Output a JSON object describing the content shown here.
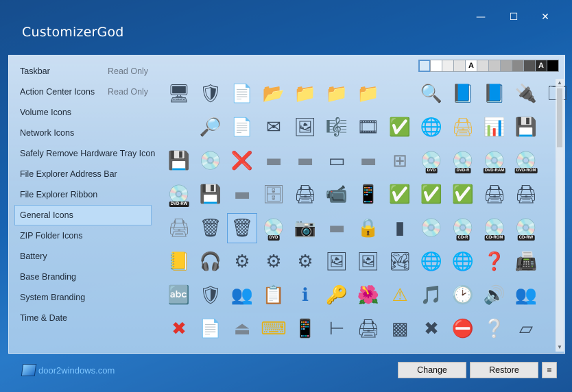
{
  "window": {
    "title": "CustomizerGod",
    "controls": {
      "minimize": "—",
      "maximize": "☐",
      "close": "✕"
    }
  },
  "sidebar": {
    "items": [
      {
        "label": "Taskbar",
        "status": "Read Only",
        "selected": false
      },
      {
        "label": "Action Center Icons",
        "status": "Read Only",
        "selected": false
      },
      {
        "label": "Volume Icons",
        "status": "",
        "selected": false
      },
      {
        "label": "Network Icons",
        "status": "",
        "selected": false
      },
      {
        "label": "Safely Remove Hardware Tray Icon",
        "status": "",
        "selected": false
      },
      {
        "label": "File Explorer Address Bar",
        "status": "",
        "selected": false
      },
      {
        "label": "File Explorer Ribbon",
        "status": "",
        "selected": false
      },
      {
        "label": "General Icons",
        "status": "",
        "selected": true
      },
      {
        "label": "ZIP Folder Icons",
        "status": "",
        "selected": false
      },
      {
        "label": "Battery",
        "status": "",
        "selected": false
      },
      {
        "label": "Base Branding",
        "status": "",
        "selected": false
      },
      {
        "label": "System Branding",
        "status": "",
        "selected": false
      },
      {
        "label": "Time & Date",
        "status": "",
        "selected": false
      }
    ]
  },
  "background_swatches": [
    {
      "color": "#d7e8f7",
      "label": "",
      "active": true
    },
    {
      "color": "#ffffff",
      "label": "",
      "active": false
    },
    {
      "color": "#eeeeee",
      "label": "",
      "active": false
    },
    {
      "color": "#e4e4e4",
      "label": "",
      "active": false
    },
    {
      "color": "#ffffff",
      "label": "A",
      "active": false
    },
    {
      "color": "#dcdcdc",
      "label": "",
      "active": false
    },
    {
      "color": "#c8c8c8",
      "label": "",
      "active": false
    },
    {
      "color": "#aaaaaa",
      "label": "",
      "active": false
    },
    {
      "color": "#8a8a8a",
      "label": "",
      "active": false
    },
    {
      "color": "#555555",
      "label": "",
      "active": false
    },
    {
      "color": "#2a2a2a",
      "label": "A",
      "active": false
    },
    {
      "color": "#000000",
      "label": "",
      "active": false
    }
  ],
  "icon_rows": [
    [
      {
        "name": "windows-display-icon",
        "glyph": "🖥"
      },
      {
        "name": "uac-shield-icon",
        "glyph": "🛡"
      },
      {
        "name": "blank-file-icon",
        "glyph": "📄"
      },
      {
        "name": "folder-open-icon",
        "glyph": "📂"
      },
      {
        "name": "folder-icon",
        "glyph": "📁"
      },
      {
        "name": "folder-icon",
        "glyph": "📁"
      },
      {
        "name": "folder-side-icon",
        "glyph": "📁"
      },
      {
        "name": "glass-file-icon",
        "glyph": ""
      },
      {
        "name": "search-globe-icon",
        "glyph": "🔍"
      },
      {
        "name": "blue-folder-icon",
        "glyph": "📘"
      },
      {
        "name": "blue-folder-side-icon",
        "glyph": "📘"
      },
      {
        "name": "network-plug-icon",
        "glyph": "🔌"
      },
      {
        "name": "window-app-icon",
        "glyph": "🗔"
      }
    ],
    [
      {
        "name": "blank-icon",
        "glyph": ""
      },
      {
        "name": "folder-search-icon",
        "glyph": "🔎"
      },
      {
        "name": "text-file-icon",
        "glyph": "📄"
      },
      {
        "name": "mail-envelope-icon",
        "glyph": "✉"
      },
      {
        "name": "picture-icon",
        "glyph": "🖼"
      },
      {
        "name": "music-sheet-icon",
        "glyph": "🎼"
      },
      {
        "name": "film-strip-icon",
        "glyph": "🎞"
      },
      {
        "name": "window-check-icon",
        "glyph": "✅"
      },
      {
        "name": "network-globe-icon",
        "glyph": "🌐"
      },
      {
        "name": "printer-folder-icon",
        "glyph": "🖨"
      },
      {
        "name": "control-panel-icon",
        "glyph": "📊"
      },
      {
        "name": "drive-floppy-icon",
        "glyph": "💾"
      },
      {
        "name": "blank-icon",
        "glyph": ""
      }
    ],
    [
      {
        "name": "drive-floppy-icon",
        "glyph": "💾"
      },
      {
        "name": "drive-cd-icon",
        "glyph": "💿"
      },
      {
        "name": "drive-disconnected-icon",
        "glyph": "❌"
      },
      {
        "name": "drive-icon",
        "glyph": "▬"
      },
      {
        "name": "drive-network-icon",
        "glyph": "▬"
      },
      {
        "name": "memory-chip-icon",
        "glyph": "▭"
      },
      {
        "name": "drive-icon",
        "glyph": "▬"
      },
      {
        "name": "drive-windows-icon",
        "glyph": "⊞"
      },
      {
        "name": "drive-dvd-icon",
        "glyph": "💿",
        "overlay": "DVD"
      },
      {
        "name": "disc-dvd-r-icon",
        "glyph": "💿",
        "overlay": "DVD-R"
      },
      {
        "name": "disc-dvd-ram-icon",
        "glyph": "💿",
        "overlay": "DVD-RAM"
      },
      {
        "name": "disc-dvd-rom-icon",
        "glyph": "💿",
        "overlay": "DVD-ROM"
      },
      {
        "name": "blank-icon",
        "glyph": ""
      }
    ],
    [
      {
        "name": "disc-dvd-rw-icon",
        "glyph": "💿",
        "overlay": "DVD-RW"
      },
      {
        "name": "drive-floppy-icon",
        "glyph": "💾"
      },
      {
        "name": "drive-usb-icon",
        "glyph": "▬"
      },
      {
        "name": "drive-server-icon",
        "glyph": "🗄"
      },
      {
        "name": "network-printer-icon",
        "glyph": "🖨"
      },
      {
        "name": "camcorder-icon",
        "glyph": "📹"
      },
      {
        "name": "mobile-phone-icon",
        "glyph": "📱"
      },
      {
        "name": "floppy-check-icon",
        "glyph": "✅"
      },
      {
        "name": "drive-check-icon",
        "glyph": "✅"
      },
      {
        "name": "drive-check-icon",
        "glyph": "✅"
      },
      {
        "name": "printer-icon",
        "glyph": "🖨"
      },
      {
        "name": "printer-floppy-icon",
        "glyph": "🖨"
      },
      {
        "name": "blank-icon",
        "glyph": ""
      }
    ],
    [
      {
        "name": "drive-printer-icon",
        "glyph": "🖨"
      },
      {
        "name": "recycle-bin-full-icon",
        "glyph": "🗑"
      },
      {
        "name": "recycle-bin-empty-icon",
        "glyph": "🗑"
      },
      {
        "name": "disc-dvd-icon",
        "glyph": "💿",
        "overlay": "DVD"
      },
      {
        "name": "camera-icon",
        "glyph": "📷"
      },
      {
        "name": "drive-icon",
        "glyph": "▬"
      },
      {
        "name": "padlock-icon",
        "glyph": "🔒"
      },
      {
        "name": "sd-card-icon",
        "glyph": "▮"
      },
      {
        "name": "disc-cd-icon",
        "glyph": "💿"
      },
      {
        "name": "disc-cd-r-icon",
        "glyph": "💿",
        "overlay": "CD-R"
      },
      {
        "name": "disc-cd-rom-icon",
        "glyph": "💿",
        "overlay": "CD-ROM"
      },
      {
        "name": "disc-cd-rw-icon",
        "glyph": "💿",
        "overlay": "CD-RW"
      },
      {
        "name": "blank-icon",
        "glyph": ""
      }
    ],
    [
      {
        "name": "contacts-book-icon",
        "glyph": "📒"
      },
      {
        "name": "media-player-icon",
        "glyph": "🎧"
      },
      {
        "name": "settings-file-icon",
        "glyph": "⚙"
      },
      {
        "name": "settings-window-icon",
        "glyph": "⚙"
      },
      {
        "name": "settings-gear-icon",
        "glyph": "⚙"
      },
      {
        "name": "pictures-icon",
        "glyph": "🖼"
      },
      {
        "name": "photos-icon",
        "glyph": "🖼"
      },
      {
        "name": "landscape-icon",
        "glyph": "🏞"
      },
      {
        "name": "folder-network-icon",
        "glyph": "🌐"
      },
      {
        "name": "globe-network-icon",
        "glyph": "🌐"
      },
      {
        "name": "drive-help-icon",
        "glyph": "❓"
      },
      {
        "name": "fax-printer-icon",
        "glyph": "📠"
      },
      {
        "name": "blank-icon",
        "glyph": ""
      }
    ],
    [
      {
        "name": "font-folder-icon",
        "glyph": "🔤"
      },
      {
        "name": "security-shield-icon",
        "glyph": "🛡"
      },
      {
        "name": "users-icon",
        "glyph": "👥"
      },
      {
        "name": "checklist-icon",
        "glyph": "📋"
      },
      {
        "name": "info-icon",
        "glyph": "ℹ"
      },
      {
        "name": "key-icon",
        "glyph": "🔑"
      },
      {
        "name": "photo-flower-icon",
        "glyph": "🌺"
      },
      {
        "name": "warning-icon",
        "glyph": "⚠"
      },
      {
        "name": "music-disc-icon",
        "glyph": "🎵"
      },
      {
        "name": "backup-clock-icon",
        "glyph": "🕑"
      },
      {
        "name": "volume-speaker-icon",
        "glyph": "🔊"
      },
      {
        "name": "users-group-icon",
        "glyph": "👥"
      },
      {
        "name": "blank-icon",
        "glyph": ""
      }
    ],
    [
      {
        "name": "red-x-icon",
        "glyph": "✖"
      },
      {
        "name": "document-icon",
        "glyph": "📄"
      },
      {
        "name": "drive-usb-plug-icon",
        "glyph": "⏏"
      },
      {
        "name": "tablet-keyboard-icon",
        "glyph": "⌨"
      },
      {
        "name": "smartphone-icon",
        "glyph": "📱"
      },
      {
        "name": "ir-port-icon",
        "glyph": "⊢"
      },
      {
        "name": "scanner-icon",
        "glyph": "🖨"
      },
      {
        "name": "bin-gray-icon",
        "glyph": "▩"
      },
      {
        "name": "gray-x-icon",
        "glyph": "✖"
      },
      {
        "name": "error-circle-icon",
        "glyph": "⛔"
      },
      {
        "name": "help-circle-icon",
        "glyph": "❔"
      },
      {
        "name": "storage-card-icon",
        "glyph": "▱"
      },
      {
        "name": "blank-icon",
        "glyph": ""
      }
    ]
  ],
  "selected_icon": {
    "row": 4,
    "col": 2
  },
  "footer": {
    "brand": "door2windows.com",
    "change_label": "Change",
    "restore_label": "Restore",
    "menu_label": "≡"
  },
  "colors": {
    "accent": "#5aa0e0",
    "error_red": "#e0322b",
    "info_blue": "#1f6fc6"
  }
}
